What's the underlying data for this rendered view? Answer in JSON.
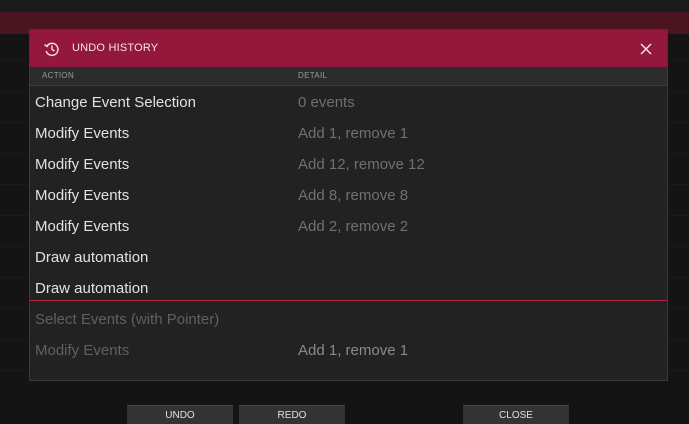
{
  "dialog": {
    "title": "UNDO HISTORY",
    "icons": {
      "title": "undo-history-icon",
      "close": "close-icon"
    },
    "columns": {
      "action": "ACTION",
      "detail": "DETAIL"
    },
    "rows": [
      {
        "action": "Change Event Selection",
        "detail": "0 events",
        "state": "active"
      },
      {
        "action": "Modify Events",
        "detail": "Add 1, remove 1",
        "state": "active"
      },
      {
        "action": "Modify Events",
        "detail": "Add 12, remove 12",
        "state": "active"
      },
      {
        "action": "Modify Events",
        "detail": "Add 8, remove 8",
        "state": "active"
      },
      {
        "action": "Modify Events",
        "detail": "Add 2, remove 2",
        "state": "active"
      },
      {
        "action": "Draw automation",
        "detail": "",
        "state": "active"
      },
      {
        "action": "Draw automation",
        "detail": "",
        "state": "active"
      },
      {
        "action": "Select Events (with Pointer)",
        "detail": "",
        "state": "undone"
      },
      {
        "action": "Modify Events",
        "detail": "Add 1, remove 1",
        "state": "undone"
      }
    ]
  },
  "footer": {
    "undo": "UNDO",
    "redo": "REDO",
    "close": "CLOSE"
  },
  "colors": {
    "accent": "#93183b",
    "divider": "#b0203f",
    "panel": "#222222"
  }
}
